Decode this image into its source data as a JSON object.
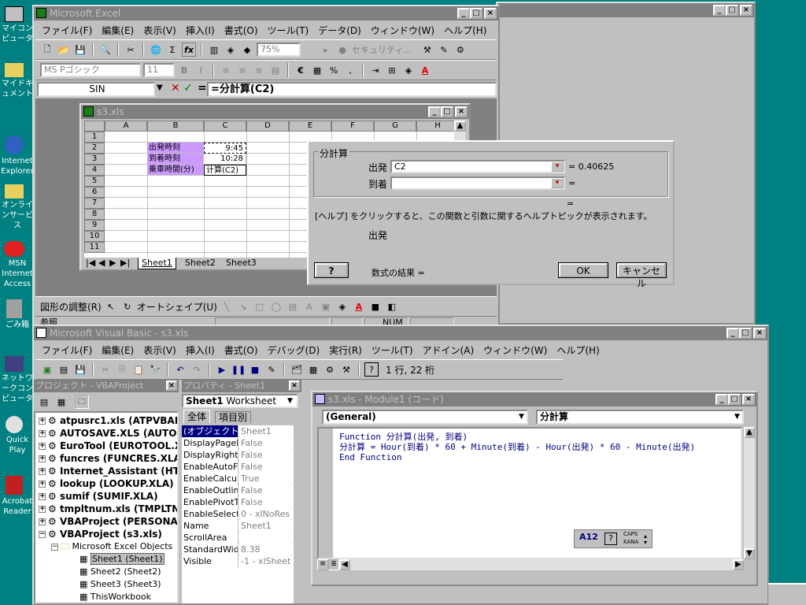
{
  "desktop": {
    "icons": [
      "マイコンピュータ",
      "マイドキュメント",
      "Internet Explorer",
      "オンラインサービス",
      "MSN Internet Access",
      "ごみ箱",
      "ネットワークコンピュータ",
      "Quick Play",
      "Acrobat Reader"
    ]
  },
  "excel": {
    "title": "Microsoft Excel",
    "menu": [
      "ファイル(F)",
      "編集(E)",
      "表示(V)",
      "挿入(I)",
      "書式(O)",
      "ツール(T)",
      "データ(D)",
      "ウィンドウ(W)",
      "ヘルプ(H)"
    ],
    "zoom": "75%",
    "security": "セキュリティ...",
    "font": "MS Pゴシック",
    "font_size": "11",
    "name_box": "SIN",
    "formula": "=分計算(C2)",
    "drawing": {
      "adjust": "図形の調整(R)",
      "autoshape": "オートシェイプ(U)"
    },
    "status": {
      "left": "参照",
      "num": "NUM"
    }
  },
  "workbook": {
    "title": "s3.xls",
    "columns": [
      "A",
      "B",
      "C",
      "D",
      "E",
      "F",
      "G",
      "H"
    ],
    "rows": [
      "1",
      "2",
      "3",
      "4",
      "5",
      "6",
      "7",
      "8",
      "9",
      "10",
      "11"
    ],
    "b2": "出発時刻",
    "b3": "到着時刻",
    "b4": "乗車時間(分)",
    "c2": "9:45",
    "c3": "10:28",
    "c4": "计算(C2)",
    "sheets": [
      "Sheet1",
      "Sheet2",
      "Sheet3"
    ]
  },
  "dialog": {
    "group": "分計算",
    "arg1_label": "出発",
    "arg1_value": "C2",
    "arg1_result": "= 0.40625",
    "arg2_label": "到着",
    "arg2_value": "",
    "arg2_result": "=",
    "eq": "=",
    "help": "[ヘルプ] をクリックすると、この関数と引数に関するヘルプトピックが表示されます。",
    "arg_name": "出発",
    "help_btn": "?",
    "result_label": "数式の結果 =",
    "ok": "OK",
    "cancel": "キャンセル"
  },
  "vbe": {
    "title": "Microsoft Visual Basic - s3.xls",
    "menu": [
      "ファイル(F)",
      "編集(E)",
      "表示(V)",
      "挿入(I)",
      "書式(O)",
      "デバッグ(D)",
      "実行(R)",
      "ツール(T)",
      "アドイン(A)",
      "ウィンドウ(W)",
      "ヘルプ(H)"
    ],
    "position": "1 行, 22 桁",
    "project": {
      "title": "プロジェクト - VBAProject",
      "items": [
        {
          "label": "atpusrc1.xls (ATPVBAE",
          "sign": "+"
        },
        {
          "label": "AUTOSAVE.XLS (AUTO",
          "sign": "+"
        },
        {
          "label": "EuroTool (EUROTOOL.X",
          "sign": "+"
        },
        {
          "label": "funcres (FUNCRES.XLA",
          "sign": "+"
        },
        {
          "label": "Internet_Assistant (HTI",
          "sign": "+"
        },
        {
          "label": "lookup (LOOKUP.XLA)",
          "sign": "+"
        },
        {
          "label": "sumif (SUMIF.XLA)",
          "sign": "+"
        },
        {
          "label": "tmpltnum.xls (TMPLTNU",
          "sign": "+"
        },
        {
          "label": "VBAProject (PERSONA",
          "sign": "+"
        },
        {
          "label": "VBAProject (s3.xls)",
          "sign": "−"
        }
      ],
      "folder": "Microsoft Excel Objects",
      "children": [
        "Sheet1 (Sheet1)",
        "Sheet2 (Sheet2)",
        "Sheet3 (Sheet3)",
        "ThisWorkbook"
      ]
    },
    "properties": {
      "title": "プロパティ - Sheet1",
      "object": "Sheet1",
      "object_type": "Worksheet",
      "tabs": [
        "全体",
        "項目別"
      ],
      "rows": [
        {
          "name": "(オブジェクト名)",
          "value": "Sheet1"
        },
        {
          "name": "DisplayPageB",
          "value": "False"
        },
        {
          "name": "DisplayRightT",
          "value": "False"
        },
        {
          "name": "EnableAutoFil",
          "value": "False"
        },
        {
          "name": "EnableCalcula",
          "value": "True"
        },
        {
          "name": "EnableOutlinir",
          "value": "False"
        },
        {
          "name": "EnablePivotTa",
          "value": "False"
        },
        {
          "name": "EnableSelecti",
          "value": "0 - xlNoRes"
        },
        {
          "name": "Name",
          "value": "Sheet1"
        },
        {
          "name": "ScrollArea",
          "value": ""
        },
        {
          "name": "StandardWidth",
          "value": "8.38"
        },
        {
          "name": "Visible",
          "value": "-1 - xlSheet"
        }
      ]
    },
    "code": {
      "title": "s3.xls - Module1 (コード)",
      "object": "(General)",
      "procedure": "分計算",
      "lines": [
        "Function 分計算(出発, 到着)",
        "分計算 = Hour(到着) * 60 + Minute(到着) - Hour(出発) * 60 - Minute(出発)",
        "End Function"
      ]
    },
    "ime": {
      "caps": "CAPS",
      "kana": "KANA"
    }
  },
  "bg_window": {
    "title": ""
  }
}
